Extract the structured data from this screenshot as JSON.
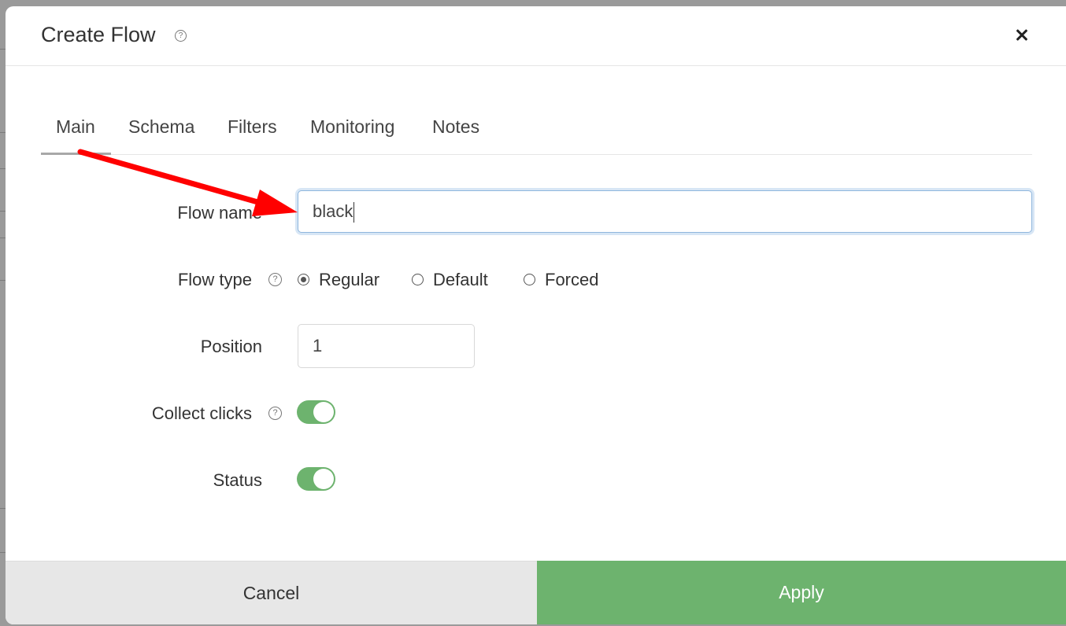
{
  "dialog": {
    "title": "Create Flow"
  },
  "tabs": [
    {
      "label": "Main",
      "active": true
    },
    {
      "label": "Schema",
      "active": false
    },
    {
      "label": "Filters",
      "active": false
    },
    {
      "label": "Monitoring",
      "active": false
    },
    {
      "label": "Notes",
      "active": false
    }
  ],
  "form": {
    "flow_name": {
      "label": "Flow name",
      "value": "black"
    },
    "flow_type": {
      "label": "Flow type",
      "options": [
        {
          "label": "Regular",
          "checked": true
        },
        {
          "label": "Default",
          "checked": false
        },
        {
          "label": "Forced",
          "checked": false
        }
      ]
    },
    "position": {
      "label": "Position",
      "value": "1"
    },
    "collect_clicks": {
      "label": "Collect clicks",
      "on": true
    },
    "status": {
      "label": "Status",
      "on": true
    }
  },
  "footer": {
    "cancel_label": "Cancel",
    "apply_label": "Apply"
  },
  "colors": {
    "accent_green": "#6db36e",
    "annotation_red": "#ff0000",
    "focus_border": "#8fb6dd"
  },
  "icons": {
    "help": "question-circle-icon",
    "close": "close-icon",
    "annotation": "red-arrow-annotation"
  }
}
